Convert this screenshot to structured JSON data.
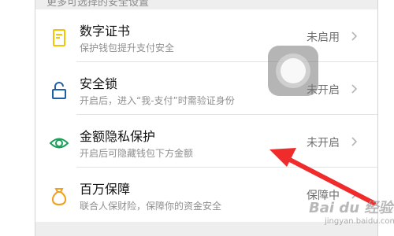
{
  "section_header": "更多可选择的安全设置",
  "rows": [
    {
      "title": "数字证书",
      "desc": "保护钱包提升支付安全",
      "status": "未启用",
      "icon": "certificate-icon",
      "color": "#f5c400"
    },
    {
      "title": "安全锁",
      "desc": "开启后，进入“我-支付”时需验证身份",
      "status": "未开启",
      "icon": "lock-icon",
      "color": "#1f5fa8"
    },
    {
      "title": "金额隐私保护",
      "desc": "开启后可隐藏钱包下方金额",
      "status": "未开启",
      "icon": "eye-icon",
      "color": "#1aa05a"
    },
    {
      "title": "百万保障",
      "desc": "联合人保财险，保障你的资金安全",
      "status": "保障中",
      "icon": "money-bag-icon",
      "color": "#f0a020"
    }
  ],
  "annotation_color": "#ef2b2b",
  "watermark": {
    "logo": "Bai du 经验",
    "url": "jingyan.baidu.com"
  }
}
